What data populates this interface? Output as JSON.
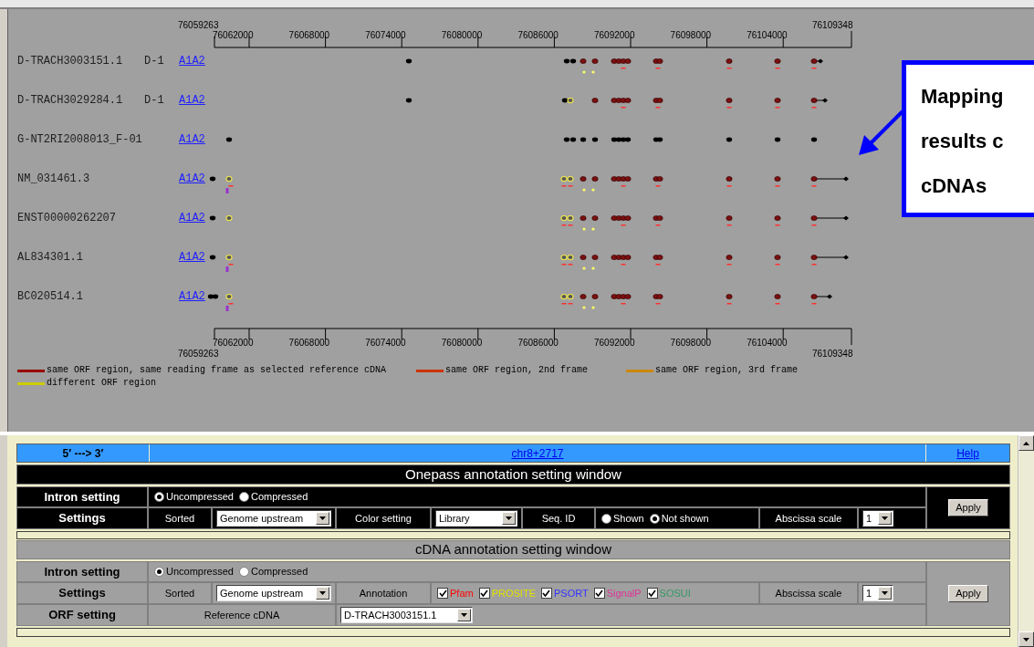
{
  "map": {
    "axis_top": {
      "start": "76059263",
      "ticks": [
        "76062000",
        "76068000",
        "76074000",
        "76080000",
        "76086000",
        "76092000",
        "76098000",
        "76104000"
      ],
      "end": "76109348"
    },
    "rows": [
      {
        "name": "D-TRACH3003151.1",
        "tag": "D-1",
        "link": "A1A2"
      },
      {
        "name": "D-TRACH3029284.1",
        "tag": "D-1",
        "link": "A1A2"
      },
      {
        "name": "G-NT2RI2008013_F-01",
        "link": "A1A2"
      },
      {
        "name": "NM_031461.3",
        "link": "A1A2"
      },
      {
        "name": "ENST00000262207",
        "link": "A1A2"
      },
      {
        "name": "AL834301.1",
        "link": "A1A2"
      },
      {
        "name": "BC020514.1",
        "link": "A1A2"
      }
    ],
    "axis_bottom": {
      "start": "76059263",
      "ticks": [
        "76062000",
        "76068000",
        "76074000",
        "76080000",
        "76086000",
        "76092000",
        "76098000",
        "76104000"
      ],
      "end": "76109348"
    },
    "legend": [
      {
        "label": "same ORF region, same reading frame as selected reference cDNA",
        "color": "#990000"
      },
      {
        "label": "same ORF region, 2nd frame",
        "color": "#cc3300"
      },
      {
        "label": "same ORF region, 3rd frame",
        "color": "#cc8800"
      },
      {
        "label": "different ORF region",
        "color": "#cccc00"
      }
    ],
    "callout": {
      "lines": [
        "Mapping",
        "results c",
        "cDNAs"
      ]
    }
  },
  "settings": {
    "header": {
      "direction": "5′ ---> 3′",
      "locus": "chr8+2717",
      "help": "Help"
    },
    "onepass": {
      "title": "Onepass annotation setting window",
      "intron": {
        "label": "Intron setting",
        "options": [
          {
            "label": "Uncompressed",
            "selected": true
          },
          {
            "label": "Compressed",
            "selected": false
          }
        ]
      },
      "settings": {
        "label": "Settings",
        "sorted_label": "Sorted",
        "sorted_value": "Genome upstream",
        "color_label": "Color setting",
        "color_value": "Library",
        "seq_id_label": "Seq. ID",
        "seq_id_options": [
          {
            "label": "Shown",
            "selected": false
          },
          {
            "label": "Not shown",
            "selected": true
          }
        ],
        "scale_label": "Abscissa scale",
        "scale_value": "1"
      },
      "apply": "Apply"
    },
    "cdna": {
      "title": "cDNA annotation setting window",
      "intron": {
        "label": "Intron setting",
        "options": [
          {
            "label": "Uncompressed",
            "selected": true
          },
          {
            "label": "Compressed",
            "selected": false
          }
        ]
      },
      "settings": {
        "label": "Settings",
        "sorted_label": "Sorted",
        "sorted_value": "Genome upstream",
        "annotation_label": "Annotation",
        "annotations": [
          {
            "label": "Pfam",
            "checked": true,
            "color": "#ff0000"
          },
          {
            "label": "PROSITE",
            "checked": true,
            "color": "#e0e000"
          },
          {
            "label": "PSORT",
            "checked": true,
            "color": "#3333ff"
          },
          {
            "label": "SignalP",
            "checked": true,
            "color": "#dd3399"
          },
          {
            "label": "SOSUI",
            "checked": true,
            "color": "#339966"
          }
        ],
        "scale_label": "Abscissa scale",
        "scale_value": "1"
      },
      "orf": {
        "label": "ORF setting",
        "reference_label": "Reference cDNA",
        "reference_value": "D-TRACH3003151.1"
      },
      "apply": "Apply"
    }
  }
}
